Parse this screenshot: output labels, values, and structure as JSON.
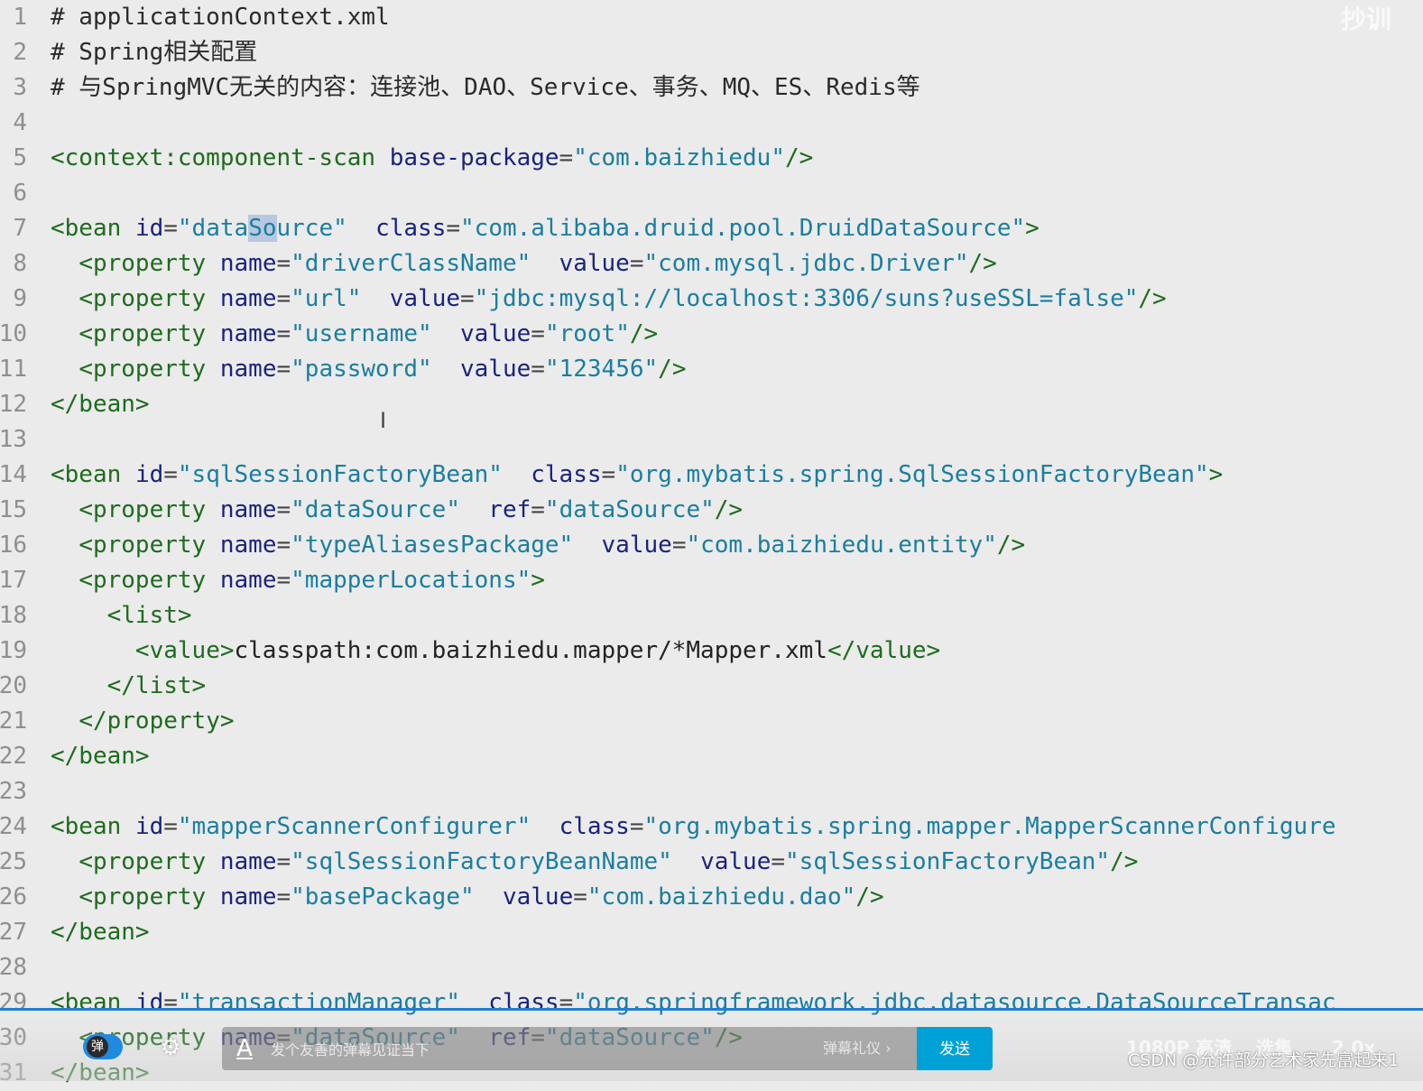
{
  "editor": {
    "lines": [
      {
        "n": "1",
        "tokens": [
          [
            "comment",
            "# applicationContext.xml"
          ]
        ]
      },
      {
        "n": "2",
        "tokens": [
          [
            "comment",
            "# Spring相关配置"
          ]
        ]
      },
      {
        "n": "3",
        "tokens": [
          [
            "comment",
            "# 与SpringMVC无关的内容：连接池、DAO、Service、事务、MQ、ES、Redis等"
          ]
        ]
      },
      {
        "n": "4",
        "tokens": []
      },
      {
        "n": "5",
        "tokens": [
          [
            "tag",
            "<context:component-scan"
          ],
          [
            "text",
            " "
          ],
          [
            "attr",
            "base-package"
          ],
          [
            "eq",
            "="
          ],
          [
            "str",
            "\"com.baizhiedu\""
          ],
          [
            "tag",
            "/>"
          ]
        ]
      },
      {
        "n": "6",
        "tokens": []
      },
      {
        "n": "7",
        "tokens": [
          [
            "tag",
            "<bean"
          ],
          [
            "text",
            " "
          ],
          [
            "attr",
            "id"
          ],
          [
            "eq",
            "="
          ],
          [
            "str",
            "\"data"
          ],
          [
            "hl",
            "So"
          ],
          [
            "str",
            "urce\""
          ],
          [
            "text",
            "  "
          ],
          [
            "attr",
            "class"
          ],
          [
            "eq",
            "="
          ],
          [
            "str",
            "\"com.alibaba.druid.pool.DruidDataSource\""
          ],
          [
            "tag",
            ">"
          ]
        ]
      },
      {
        "n": "8",
        "tokens": [
          [
            "text",
            "  "
          ],
          [
            "tag",
            "<property"
          ],
          [
            "text",
            " "
          ],
          [
            "attr",
            "name"
          ],
          [
            "eq",
            "="
          ],
          [
            "str",
            "\"driverClassName\""
          ],
          [
            "text",
            "  "
          ],
          [
            "attr",
            "value"
          ],
          [
            "eq",
            "="
          ],
          [
            "str",
            "\"com.mysql.jdbc.Driver\""
          ],
          [
            "tag",
            "/>"
          ]
        ]
      },
      {
        "n": "9",
        "tokens": [
          [
            "text",
            "  "
          ],
          [
            "tag",
            "<property"
          ],
          [
            "text",
            " "
          ],
          [
            "attr",
            "name"
          ],
          [
            "eq",
            "="
          ],
          [
            "str",
            "\"url\""
          ],
          [
            "text",
            "  "
          ],
          [
            "attr",
            "value"
          ],
          [
            "eq",
            "="
          ],
          [
            "str",
            "\"jdbc:mysql://localhost:3306/suns?useSSL=false\""
          ],
          [
            "tag",
            "/>"
          ]
        ]
      },
      {
        "n": "10",
        "tokens": [
          [
            "text",
            "  "
          ],
          [
            "tag",
            "<property"
          ],
          [
            "text",
            " "
          ],
          [
            "attr",
            "name"
          ],
          [
            "eq",
            "="
          ],
          [
            "str",
            "\"username\""
          ],
          [
            "text",
            "  "
          ],
          [
            "attr",
            "value"
          ],
          [
            "eq",
            "="
          ],
          [
            "str",
            "\"root\""
          ],
          [
            "tag",
            "/>"
          ]
        ]
      },
      {
        "n": "11",
        "tokens": [
          [
            "text",
            "  "
          ],
          [
            "tag",
            "<property"
          ],
          [
            "text",
            " "
          ],
          [
            "attr",
            "name"
          ],
          [
            "eq",
            "="
          ],
          [
            "str",
            "\"password\""
          ],
          [
            "text",
            "  "
          ],
          [
            "attr",
            "value"
          ],
          [
            "eq",
            "="
          ],
          [
            "str",
            "\"123456\""
          ],
          [
            "tag",
            "/>"
          ]
        ]
      },
      {
        "n": "12",
        "tokens": [
          [
            "tag",
            "</bean>"
          ]
        ]
      },
      {
        "n": "13",
        "tokens": []
      },
      {
        "n": "14",
        "tokens": [
          [
            "tag",
            "<bean"
          ],
          [
            "text",
            " "
          ],
          [
            "attr",
            "id"
          ],
          [
            "eq",
            "="
          ],
          [
            "str",
            "\"sqlSessionFactoryBean\""
          ],
          [
            "text",
            "  "
          ],
          [
            "attr",
            "class"
          ],
          [
            "eq",
            "="
          ],
          [
            "str",
            "\"org.mybatis.spring.SqlSessionFactoryBean\""
          ],
          [
            "tag",
            ">"
          ]
        ]
      },
      {
        "n": "15",
        "tokens": [
          [
            "text",
            "  "
          ],
          [
            "tag",
            "<property"
          ],
          [
            "text",
            " "
          ],
          [
            "attr",
            "name"
          ],
          [
            "eq",
            "="
          ],
          [
            "str",
            "\"dataSource\""
          ],
          [
            "text",
            "  "
          ],
          [
            "attr",
            "ref"
          ],
          [
            "eq",
            "="
          ],
          [
            "str",
            "\"dataSource\""
          ],
          [
            "tag",
            "/>"
          ]
        ]
      },
      {
        "n": "16",
        "tokens": [
          [
            "text",
            "  "
          ],
          [
            "tag",
            "<property"
          ],
          [
            "text",
            " "
          ],
          [
            "attr",
            "name"
          ],
          [
            "eq",
            "="
          ],
          [
            "str",
            "\"typeAliasesPackage\""
          ],
          [
            "text",
            "  "
          ],
          [
            "attr",
            "value"
          ],
          [
            "eq",
            "="
          ],
          [
            "str",
            "\"com.baizhiedu.entity\""
          ],
          [
            "tag",
            "/>"
          ]
        ]
      },
      {
        "n": "17",
        "tokens": [
          [
            "text",
            "  "
          ],
          [
            "tag",
            "<property"
          ],
          [
            "text",
            " "
          ],
          [
            "attr",
            "name"
          ],
          [
            "eq",
            "="
          ],
          [
            "str",
            "\"mapperLocations\""
          ],
          [
            "tag",
            ">"
          ]
        ]
      },
      {
        "n": "18",
        "tokens": [
          [
            "text",
            "    "
          ],
          [
            "tag",
            "<list>"
          ]
        ]
      },
      {
        "n": "19",
        "tokens": [
          [
            "text",
            "      "
          ],
          [
            "tag",
            "<value>"
          ],
          [
            "text",
            "classpath:com.baizhiedu.mapper/*Mapper.xml"
          ],
          [
            "tag",
            "</value>"
          ]
        ]
      },
      {
        "n": "20",
        "tokens": [
          [
            "text",
            "    "
          ],
          [
            "tag",
            "</list>"
          ]
        ]
      },
      {
        "n": "21",
        "tokens": [
          [
            "text",
            "  "
          ],
          [
            "tag",
            "</property>"
          ]
        ]
      },
      {
        "n": "22",
        "tokens": [
          [
            "tag",
            "</bean>"
          ]
        ]
      },
      {
        "n": "23",
        "tokens": []
      },
      {
        "n": "24",
        "tokens": [
          [
            "tag",
            "<bean"
          ],
          [
            "text",
            " "
          ],
          [
            "attr",
            "id"
          ],
          [
            "eq",
            "="
          ],
          [
            "str",
            "\"mapperScannerConfigurer\""
          ],
          [
            "text",
            "  "
          ],
          [
            "attr",
            "class"
          ],
          [
            "eq",
            "="
          ],
          [
            "str",
            "\"org.mybatis.spring.mapper.MapperScannerConfigure"
          ]
        ]
      },
      {
        "n": "25",
        "tokens": [
          [
            "text",
            "  "
          ],
          [
            "tag",
            "<property"
          ],
          [
            "text",
            " "
          ],
          [
            "attr",
            "name"
          ],
          [
            "eq",
            "="
          ],
          [
            "str",
            "\"sqlSessionFactoryBeanName\""
          ],
          [
            "text",
            "  "
          ],
          [
            "attr",
            "value"
          ],
          [
            "eq",
            "="
          ],
          [
            "str",
            "\"sqlSessionFactoryBean\""
          ],
          [
            "tag",
            "/>"
          ]
        ]
      },
      {
        "n": "26",
        "tokens": [
          [
            "text",
            "  "
          ],
          [
            "tag",
            "<property"
          ],
          [
            "text",
            " "
          ],
          [
            "attr",
            "name"
          ],
          [
            "eq",
            "="
          ],
          [
            "str",
            "\"basePackage\""
          ],
          [
            "text",
            "  "
          ],
          [
            "attr",
            "value"
          ],
          [
            "eq",
            "="
          ],
          [
            "str",
            "\"com.baizhiedu.dao\""
          ],
          [
            "tag",
            "/>"
          ]
        ]
      },
      {
        "n": "27",
        "tokens": [
          [
            "tag",
            "</bean>"
          ]
        ]
      },
      {
        "n": "28",
        "tokens": []
      },
      {
        "n": "29",
        "tokens": [
          [
            "tag",
            "<bean"
          ],
          [
            "text",
            " "
          ],
          [
            "attr",
            "id"
          ],
          [
            "eq",
            "="
          ],
          [
            "str",
            "\"transactionManager\""
          ],
          [
            "text",
            "  "
          ],
          [
            "attr",
            "class"
          ],
          [
            "eq",
            "="
          ],
          [
            "str",
            "\"org.springframework.jdbc.datasource.DataSourceTransac"
          ]
        ]
      },
      {
        "n": "30",
        "tokens": [
          [
            "text",
            "  "
          ],
          [
            "tag",
            "<property"
          ],
          [
            "text",
            " "
          ],
          [
            "attr",
            "name"
          ],
          [
            "eq",
            "="
          ],
          [
            "str",
            "\"dataSource\""
          ],
          [
            "text",
            "  "
          ],
          [
            "attr",
            "ref"
          ],
          [
            "eq",
            "="
          ],
          [
            "str",
            "\"dataSource\""
          ],
          [
            "tag",
            "/>"
          ]
        ]
      },
      {
        "n": "31",
        "tokens": [
          [
            "tag",
            "</bean>"
          ]
        ]
      }
    ]
  },
  "player": {
    "danmaku_toggle_label": "弹",
    "danmaku_placeholder": "发个友善的弹幕见证当下",
    "danmaku_style_glyph": "A",
    "gift_label": "弹幕礼仪 ›",
    "send_label": "发送",
    "quality_label": "1080P 高清",
    "episodes_label": "选集",
    "speed_label": "2.0x",
    "progress_color": "#1e7fd6",
    "send_color": "#00a1d6"
  },
  "watermark": "CSDN @允许部分艺术家先富起来1",
  "corner_logo": "抄训"
}
